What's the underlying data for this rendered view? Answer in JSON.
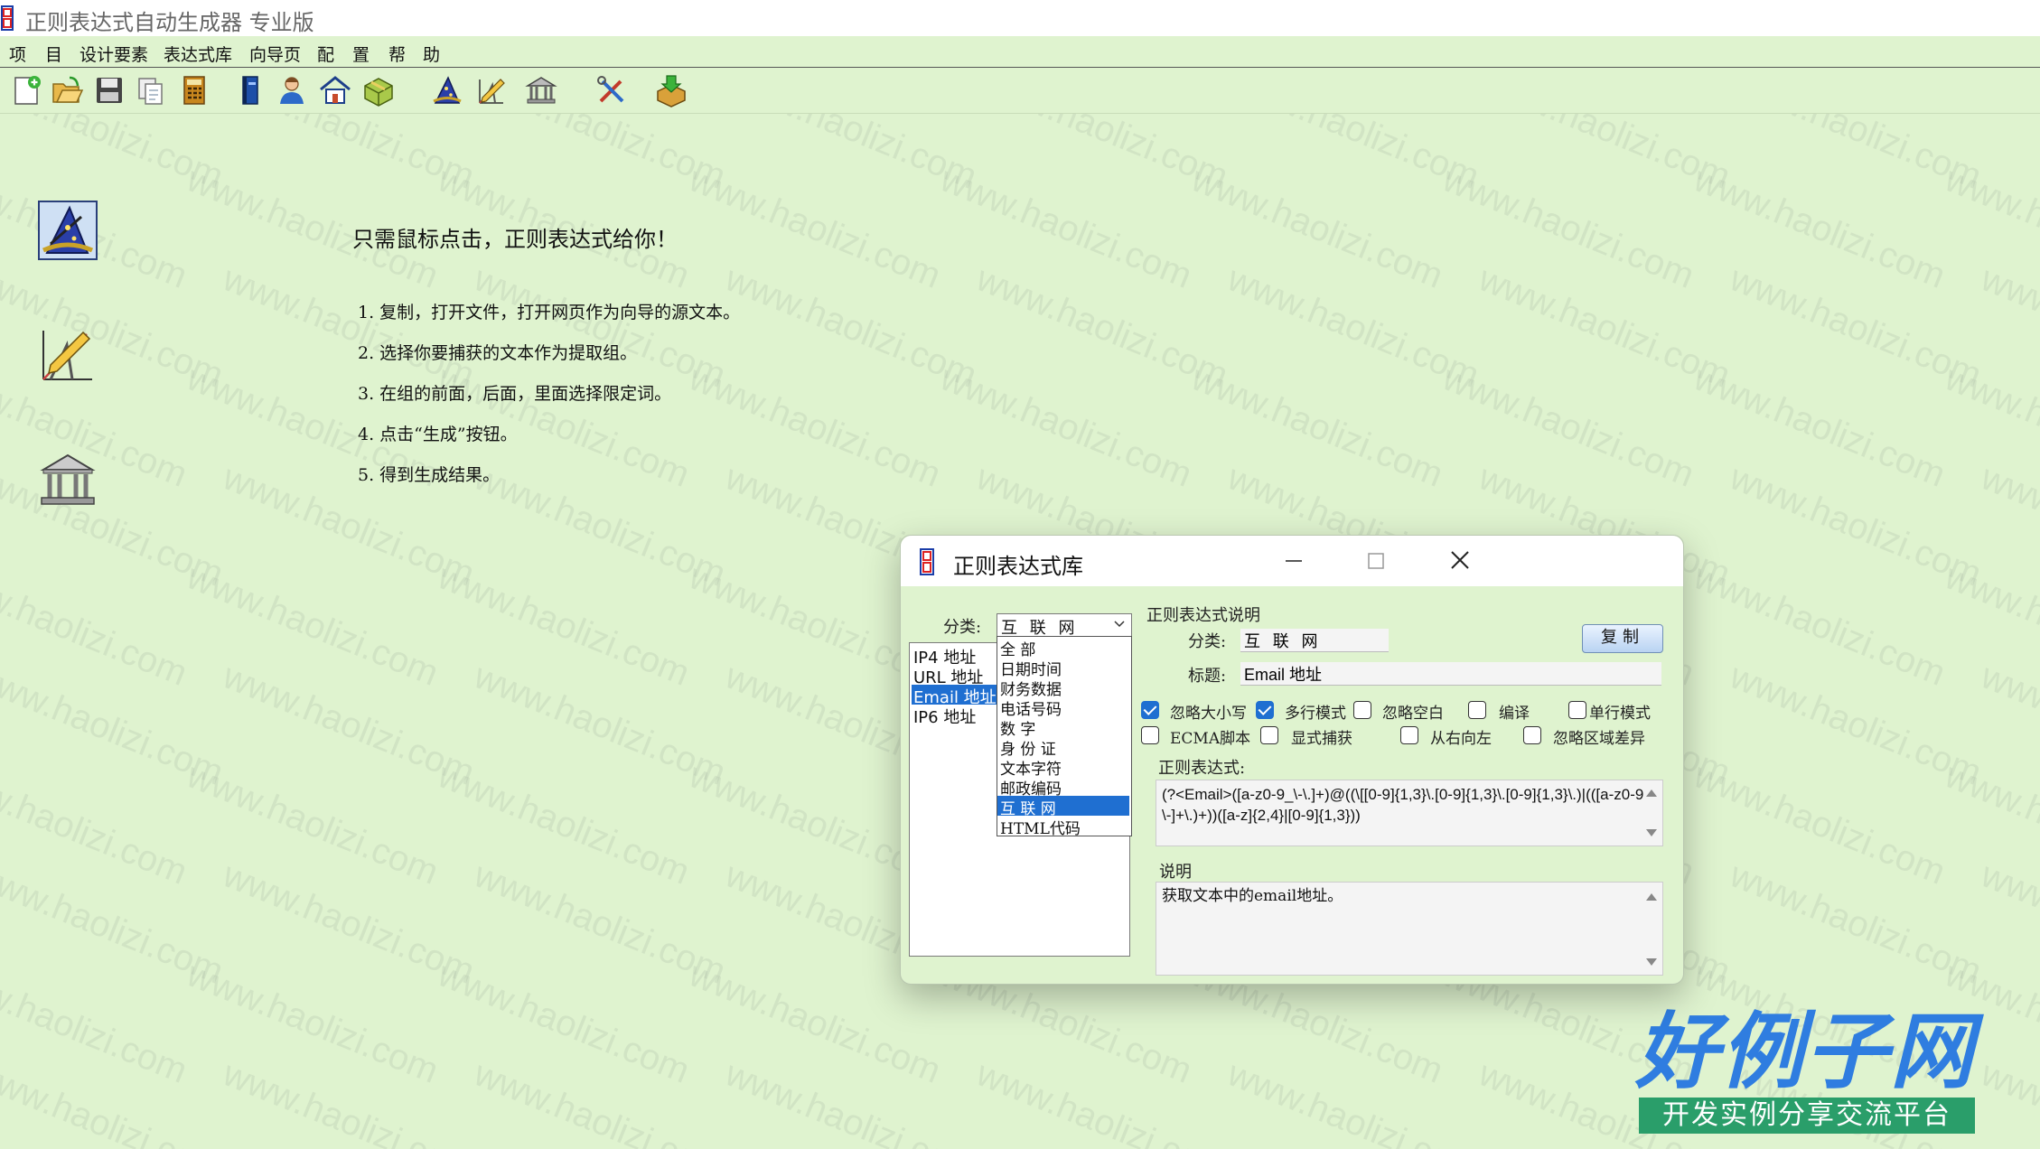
{
  "app": {
    "title": "正则表达式自动生成器 专业版"
  },
  "menu": [
    "项",
    "目",
    "设计要素",
    "表达式库",
    "向导页",
    "配",
    "置",
    "帮",
    "助"
  ],
  "toolbar_icons": [
    "new-file-icon",
    "open-folder-icon",
    "save-disk-icon",
    "copy-pages-icon",
    "calculator-icon",
    "book-icon",
    "user-icon",
    "home-icon",
    "package-icon",
    "wizard-hat-icon",
    "drafting-tools-icon",
    "library-building-icon",
    "tools-icon",
    "download-box-icon"
  ],
  "side_icons": [
    "wizard-hat-icon",
    "drafting-tools-icon",
    "library-building-icon"
  ],
  "main": {
    "headline": "只需鼠标点击，正则表达式给你！",
    "steps": [
      "1. 复制，打开文件，打开网页作为向导的源文本。",
      "2. 选择你要捕获的文本作为提取组。",
      "3. 在组的前面，后面，里面选择限定词。",
      "4. 点击“生成”按钮。",
      "5. 得到生成结果。"
    ]
  },
  "dialog": {
    "title": "正则表达式库",
    "category_label": "分类:",
    "category_value": "互 联 网",
    "list_items": [
      "IP4 地址",
      "URL 地址",
      "Email 地址",
      "IP6 地址"
    ],
    "selected_list_index": 2,
    "dropdown_options": [
      "全  部",
      "日期时间",
      "财务数据",
      "电话号码",
      "数    字",
      "身 份 证",
      "文本字符",
      "邮政编码",
      "互 联 网",
      "HTML代码"
    ],
    "selected_dropdown_index": 8,
    "section_title": "正则表达式说明",
    "detail_category_label": "分类:",
    "detail_category_value": "互 联 网",
    "copy_button": "复制",
    "subject_label": "标题:",
    "subject_value": "Email 地址",
    "options": [
      {
        "label": "忽略大小写",
        "checked": true
      },
      {
        "label": "多行模式",
        "checked": true
      },
      {
        "label": "忽略空白",
        "checked": false
      },
      {
        "label": "编译",
        "checked": false
      },
      {
        "label": "单行模式",
        "checked": false
      },
      {
        "label": "ECMA脚本",
        "checked": false
      },
      {
        "label": "显式捕获",
        "checked": false
      },
      {
        "label": "从右向左",
        "checked": false
      },
      {
        "label": "忽略区域差异",
        "checked": false
      }
    ],
    "regex_label": "正则表达式:",
    "regex_value": "(?<Email>([a-z0-9_\\-\\.]+)@((\\[[0-9]{1,3}\\.[0-9]{1,3}\\.[0-9]{1,3}\\.)|(([a-z0-9\\-]+\\.)+))([a-z]{2,4}|[0-9]{1,3}))",
    "desc_label": "说明",
    "desc_value": "获取文本中的email地址。"
  },
  "logo": {
    "main": "好例子网",
    "sub": "开发实例分享交流平台"
  },
  "colors": {
    "background": "#dff3cf",
    "selection": "#1f6fd1",
    "logo_blue": "#2f7de0",
    "logo_green": "#2a9e6a"
  }
}
